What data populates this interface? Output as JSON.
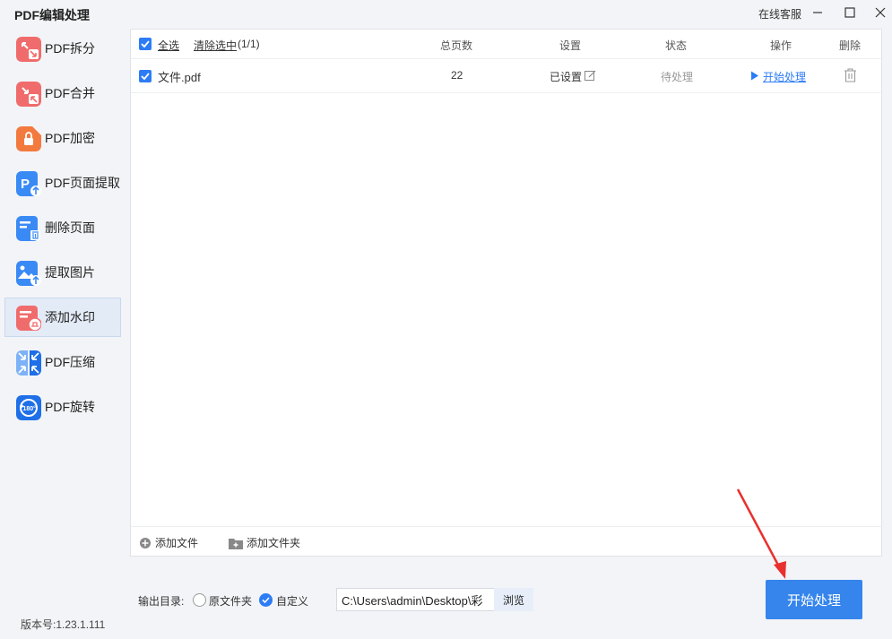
{
  "app": {
    "title": "PDF编辑处理",
    "support_label": "在线客服",
    "version": "版本号:1.23.1.111"
  },
  "sidebar": {
    "items": [
      {
        "label": "PDF拆分",
        "icon": "split-icon",
        "color": "#f06c6c"
      },
      {
        "label": "PDF合并",
        "icon": "merge-icon",
        "color": "#f06c6c"
      },
      {
        "label": "PDF加密",
        "icon": "lock-icon",
        "color": "#f37a3f"
      },
      {
        "label": "PDF页面提取",
        "icon": "page-extract-icon",
        "color": "#3a8af5"
      },
      {
        "label": "删除页面",
        "icon": "delete-page-icon",
        "color": "#3a8af5"
      },
      {
        "label": "提取图片",
        "icon": "image-extract-icon",
        "color": "#3a8af5"
      },
      {
        "label": "添加水印",
        "icon": "watermark-icon",
        "color": "#f06c6c",
        "active": true
      },
      {
        "label": "PDF压缩",
        "icon": "compress-icon",
        "color": "#3a8af5"
      },
      {
        "label": "PDF旋转",
        "icon": "rotate-icon",
        "color": "#1e6fe8"
      }
    ]
  },
  "table": {
    "select_all": "全选",
    "clear_selected": "清除选中",
    "selected_count": "(1/1)",
    "columns": {
      "pages": "总页数",
      "settings": "设置",
      "status": "状态",
      "action": "操作",
      "delete": "删除"
    },
    "rows": [
      {
        "checked": true,
        "filename": "文件.pdf",
        "pages": "22",
        "settings": "已设置",
        "status": "待处理",
        "action": "开始处理"
      }
    ]
  },
  "toolbar": {
    "add_file": "添加文件",
    "add_folder": "添加文件夹"
  },
  "output": {
    "label": "输出目录:",
    "option_original": "原文件夹",
    "option_custom": "自定义",
    "selected": "custom",
    "path": "C:\\Users\\admin\\Desktop\\彩",
    "browse": "浏览"
  },
  "start_button": "开始处理",
  "colors": {
    "accent": "#3585ec",
    "annotation_arrow": "#e8312e"
  }
}
